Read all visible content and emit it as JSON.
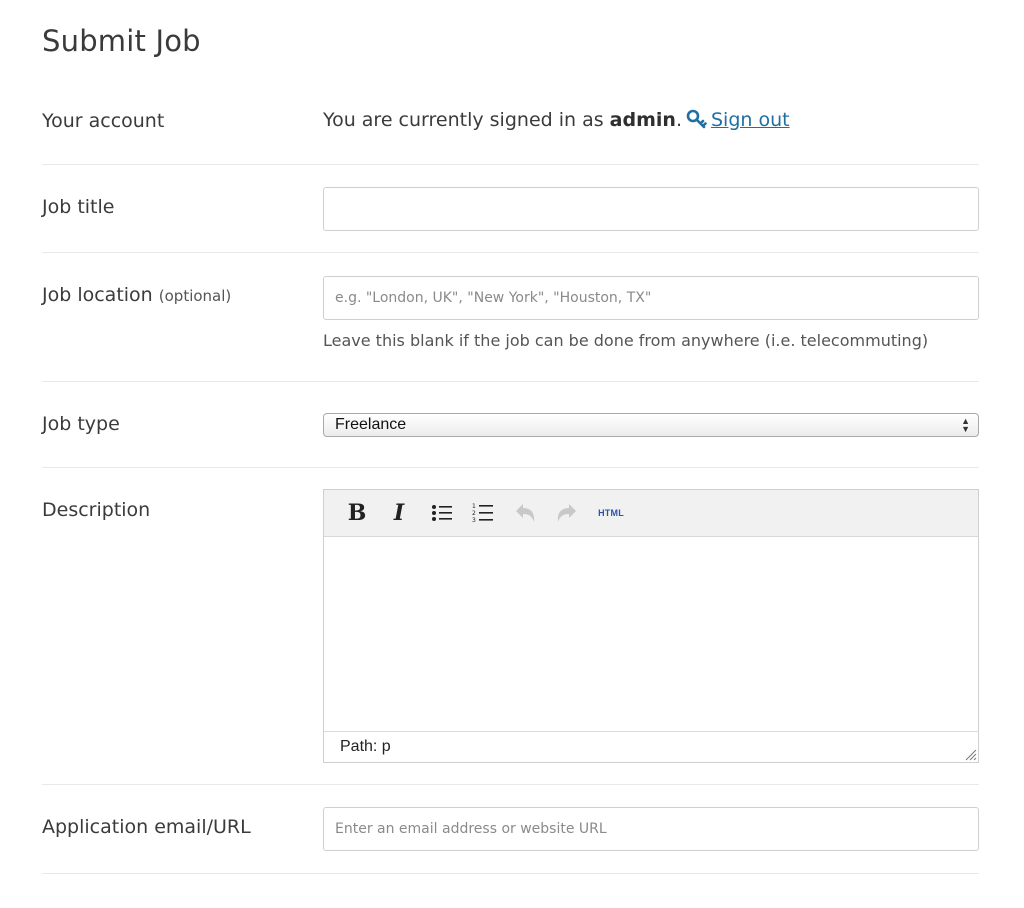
{
  "page": {
    "title": "Submit Job"
  },
  "account": {
    "label": "Your account",
    "text_prefix": "You are currently signed in as ",
    "username": "admin",
    "text_suffix": ".",
    "signout_label": "Sign out"
  },
  "job_title": {
    "label": "Job title",
    "value": "",
    "placeholder": ""
  },
  "job_location": {
    "label": "Job location",
    "optional_label": "(optional)",
    "value": "",
    "placeholder": "e.g. \"London, UK\", \"New York\", \"Houston, TX\"",
    "helper": "Leave this blank if the job can be done from anywhere (i.e. telecommuting)"
  },
  "job_type": {
    "label": "Job type",
    "selected": "Freelance"
  },
  "description": {
    "label": "Description",
    "toolbar": {
      "bold": "B",
      "italic": "I",
      "bullet_list_icon": "bullet-list-icon",
      "numbered_list_icon": "numbered-list-icon",
      "undo_icon": "undo-icon",
      "redo_icon": "redo-icon",
      "html_label": "HTML"
    },
    "value": "",
    "path_label": "Path: p"
  },
  "application": {
    "label": "Application email/URL",
    "value": "",
    "placeholder": "Enter an email address or website URL"
  },
  "colors": {
    "link": "#1f6fa3",
    "text": "#3b3b3b",
    "border": "#cfcfcf"
  }
}
